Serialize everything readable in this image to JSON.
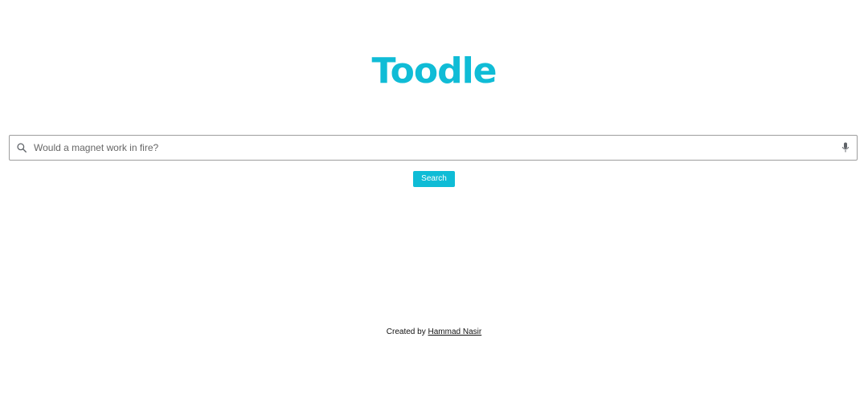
{
  "logo": {
    "text": "Toodle"
  },
  "search": {
    "placeholder": "Would a magnet work in fire?",
    "value": "",
    "search_icon": "search-icon",
    "mic_icon": "microphone-icon"
  },
  "actions": {
    "search_label": "Search"
  },
  "footer": {
    "created_by": "Created by",
    "author_link": "Hammad Nasir"
  },
  "colors": {
    "brand": "#10bcd6",
    "button_bg": "#0fbcd6",
    "button_text": "#ffffff",
    "border": "#9e9e9e"
  }
}
